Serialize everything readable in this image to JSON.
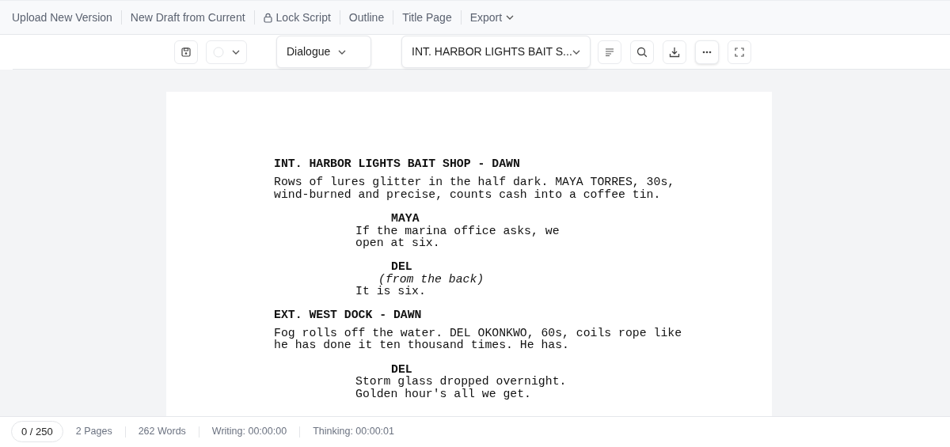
{
  "menu": [
    {
      "label": "Upload New Version",
      "kind": "plain"
    },
    {
      "label": "New Draft from Current",
      "kind": "plain"
    },
    {
      "label": "Lock Script",
      "kind": "lock"
    },
    {
      "label": "Outline",
      "kind": "plain"
    },
    {
      "label": "Title Page",
      "kind": "plain"
    },
    {
      "label": "Export",
      "kind": "dropdown"
    }
  ],
  "toolbar": {
    "element_type": "Dialogue",
    "scene": "INT. HARBOR LIGHTS BAIT S..."
  },
  "script": [
    {
      "kind": "scene",
      "text": "INT. HARBOR LIGHTS BAIT SHOP - DAWN"
    },
    {
      "kind": "action",
      "text": "Rows of lures glitter in the half dark. MAYA TORRES, 30s, wind-burned and precise, counts cash into a coffee tin."
    },
    {
      "kind": "character",
      "text": "MAYA"
    },
    {
      "kind": "dialogue",
      "text": "If the marina office asks, we open at six."
    },
    {
      "kind": "character",
      "text": "DEL"
    },
    {
      "kind": "parenthetical",
      "text": "(from the back)"
    },
    {
      "kind": "dialogue",
      "text": "It is six."
    },
    {
      "kind": "scene",
      "text": "EXT. WEST DOCK - DAWN"
    },
    {
      "kind": "action",
      "text": "Fog rolls off the water. DEL OKONKWO, 60s, coils rope like he has done it ten thousand times. He has."
    },
    {
      "kind": "character",
      "text": "DEL"
    },
    {
      "kind": "dialogue",
      "text": "Storm glass dropped overnight. Golden hour's all we get."
    }
  ],
  "status_bar": {
    "counter": "0 / 250",
    "stats": [
      "2 Pages",
      "262 Words",
      "Writing: 00:00:00",
      "Thinking: 00:00:01"
    ]
  }
}
